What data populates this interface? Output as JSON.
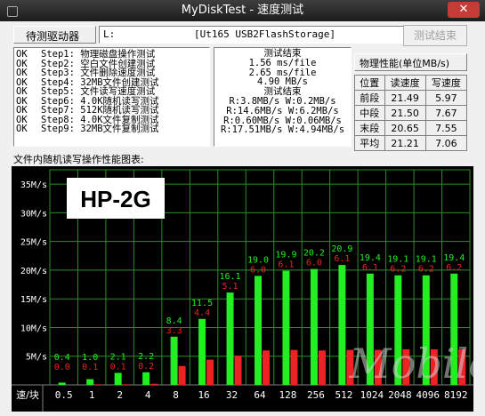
{
  "window": {
    "title": "MyDiskTest - 速度测试",
    "close_label": "✕"
  },
  "drive": {
    "label": "待测驱动器",
    "letter": "L:",
    "name": "[Ut165 USB2FlashStorage]",
    "test_button": "测试结束"
  },
  "steps": [
    {
      "status": "OK",
      "text": "Step1: 物理磁盘操作测试"
    },
    {
      "status": "OK",
      "text": "Step2: 空白文件创建测试"
    },
    {
      "status": "OK",
      "text": "Step3: 文件删除速度测试"
    },
    {
      "status": "OK",
      "text": "Step4: 32MB文件创建测试"
    },
    {
      "status": "OK",
      "text": "Step5: 文件读写速度测试"
    },
    {
      "status": "OK",
      "text": "Step6: 4.0K随机读写测试"
    },
    {
      "status": "OK",
      "text": "Step7: 512K随机读写测试"
    },
    {
      "status": "OK",
      "text": "Step8: 4.0K文件复制测试"
    },
    {
      "status": "OK",
      "text": "Step9: 32MB文件复制测试"
    }
  ],
  "results": [
    "测试结束",
    "1.56 ms/file",
    "2.65 ms/file",
    "4.90 MB/s",
    "测试结束",
    "R:3.8MB/s W:0.2MB/s",
    "R:14.6MB/s W:6.2MB/s",
    "R:0.60MB/s W:0.06MB/s",
    "R:17.51MB/s W:4.94MB/s"
  ],
  "performance": {
    "header": "物理性能(单位MB/s)",
    "columns": [
      "位置",
      "读速度",
      "写速度"
    ],
    "rows": [
      [
        "前段",
        "21.49",
        "5.97"
      ],
      [
        "中段",
        "21.50",
        "7.67"
      ],
      [
        "末段",
        "20.65",
        "7.55"
      ],
      [
        "平均",
        "21.21",
        "7.06"
      ]
    ]
  },
  "chart_title": "文件内随机读写操作性能图表:",
  "chart_data": {
    "type": "bar",
    "overlay_label": "HP-2G",
    "watermark": "Mobile",
    "x_axis_label": "速/块",
    "categories": [
      "0.5",
      "1",
      "2",
      "4",
      "8",
      "16",
      "32",
      "64",
      "128",
      "256",
      "512",
      "1024",
      "2048",
      "4096",
      "8192"
    ],
    "y_ticks": [
      "5M/s",
      "10M/s",
      "15M/s",
      "20M/s",
      "25M/s",
      "30M/s",
      "35M/s"
    ],
    "ylim": [
      0,
      37.5
    ],
    "grid": true,
    "series": [
      {
        "name": "读",
        "color": "#22ee22",
        "values": [
          0.4,
          1.0,
          2.1,
          2.2,
          8.4,
          11.5,
          16.1,
          19.0,
          19.9,
          20.2,
          20.9,
          19.4,
          19.1,
          19.1,
          19.4
        ]
      },
      {
        "name": "写",
        "color": "#ee2222",
        "values": [
          0.0,
          0.1,
          0.1,
          0.2,
          3.3,
          4.4,
          5.1,
          6.0,
          6.1,
          6.0,
          6.1,
          6.1,
          6.2,
          6.2,
          6.2
        ]
      }
    ],
    "value_labels": {
      "read": [
        "0.4",
        "1.0",
        "2.1",
        "2.2",
        "8.4",
        "11.5",
        "16.1",
        "19.0",
        "19.9",
        "20.2",
        "20.9",
        "19.4",
        "19.1",
        "19.1",
        "19.4"
      ],
      "write": [
        "0.0",
        "0.1",
        "0.1",
        "0.2",
        "3.3",
        "4.4",
        "5.1",
        "6.0",
        "6.1",
        "6.0",
        "6.1",
        "6.1",
        "6.2",
        "6.2",
        "6.2"
      ]
    }
  }
}
